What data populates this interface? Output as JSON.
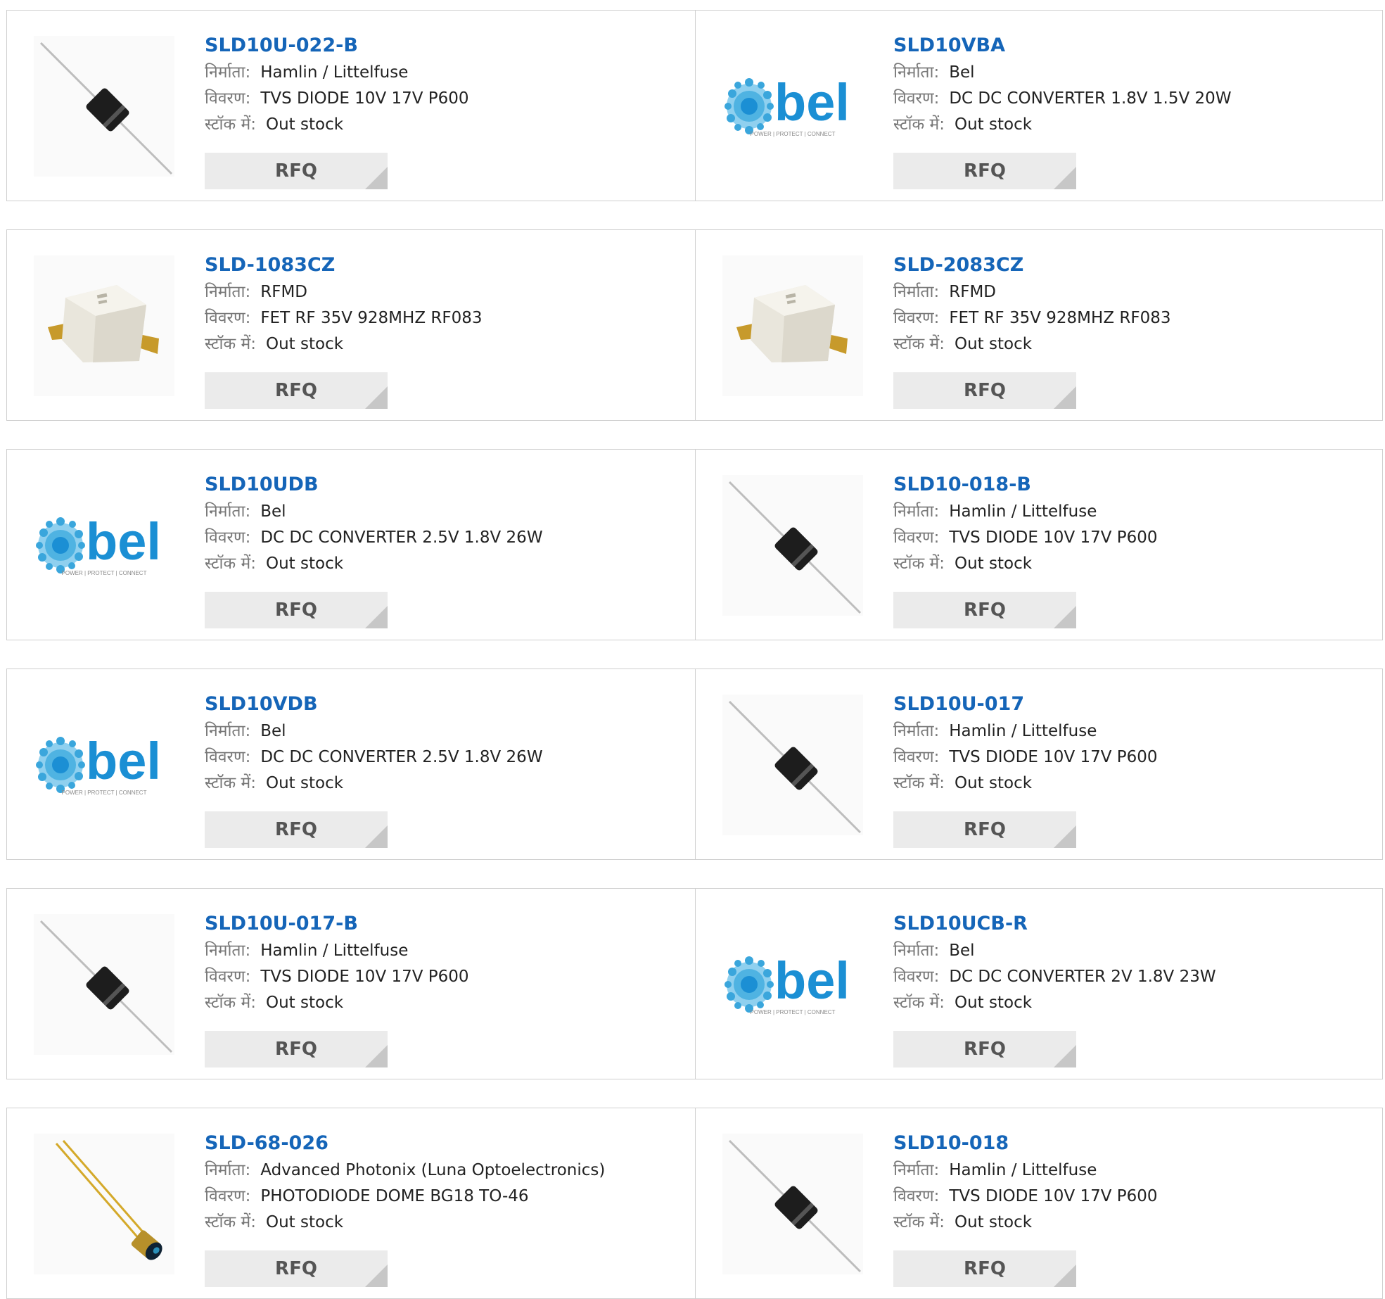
{
  "labels": {
    "manufacturer": "निर्माता:",
    "description": "विवरण:",
    "stock": "स्टॉक में:"
  },
  "rfq_label": "RFQ",
  "colors": {
    "part_link": "#1565b8",
    "bel_brand": "#1b8fd4",
    "border": "#cfcfcf",
    "button_bg": "#ebebeb"
  },
  "products": [
    {
      "part": "SLD10U-022-B",
      "manufacturer": "Hamlin / Littelfuse",
      "description": "TVS DIODE 10V 17V P600",
      "stock": "Out stock",
      "image": "tvs-diode-icon"
    },
    {
      "part": "SLD10VBA",
      "manufacturer": "Bel",
      "description": "DC DC CONVERTER 1.8V 1.5V 20W",
      "stock": "Out stock",
      "image": "bel-logo",
      "logo_text": "bel",
      "logo_tagline": "POWER | PROTECT | CONNECT"
    },
    {
      "part": "SLD-1083CZ",
      "manufacturer": "RFMD",
      "description": "FET RF 35V 928MHZ RF083",
      "stock": "Out stock",
      "image": "rf-fet-package-icon"
    },
    {
      "part": "SLD-2083CZ",
      "manufacturer": "RFMD",
      "description": "FET RF 35V 928MHZ RF083",
      "stock": "Out stock",
      "image": "rf-fet-package-icon"
    },
    {
      "part": "SLD10UDB",
      "manufacturer": "Bel",
      "description": "DC DC CONVERTER 2.5V 1.8V 26W",
      "stock": "Out stock",
      "image": "bel-logo",
      "logo_text": "bel",
      "logo_tagline": "POWER | PROTECT | CONNECT"
    },
    {
      "part": "SLD10-018-B",
      "manufacturer": "Hamlin / Littelfuse",
      "description": "TVS DIODE 10V 17V P600",
      "stock": "Out stock",
      "image": "tvs-diode-icon"
    },
    {
      "part": "SLD10VDB",
      "manufacturer": "Bel",
      "description": "DC DC CONVERTER 2.5V 1.8V 26W",
      "stock": "Out stock",
      "image": "bel-logo",
      "logo_text": "bel",
      "logo_tagline": "POWER | PROTECT | CONNECT"
    },
    {
      "part": "SLD10U-017",
      "manufacturer": "Hamlin / Littelfuse",
      "description": "TVS DIODE 10V 17V P600",
      "stock": "Out stock",
      "image": "tvs-diode-icon"
    },
    {
      "part": "SLD10U-017-B",
      "manufacturer": "Hamlin / Littelfuse",
      "description": "TVS DIODE 10V 17V P600",
      "stock": "Out stock",
      "image": "tvs-diode-icon"
    },
    {
      "part": "SLD10UCB-R",
      "manufacturer": "Bel",
      "description": "DC DC CONVERTER 2V 1.8V 23W",
      "stock": "Out stock",
      "image": "bel-logo",
      "logo_text": "bel",
      "logo_tagline": "POWER | PROTECT | CONNECT"
    },
    {
      "part": "SLD-68-026",
      "manufacturer": "Advanced Photonix (Luna Optoelectronics)",
      "description": "PHOTODIODE DOME BG18 TO-46",
      "stock": "Out stock",
      "image": "photodiode-icon"
    },
    {
      "part": "SLD10-018",
      "manufacturer": "Hamlin / Littelfuse",
      "description": "TVS DIODE 10V 17V P600",
      "stock": "Out stock",
      "image": "tvs-diode-icon"
    }
  ]
}
